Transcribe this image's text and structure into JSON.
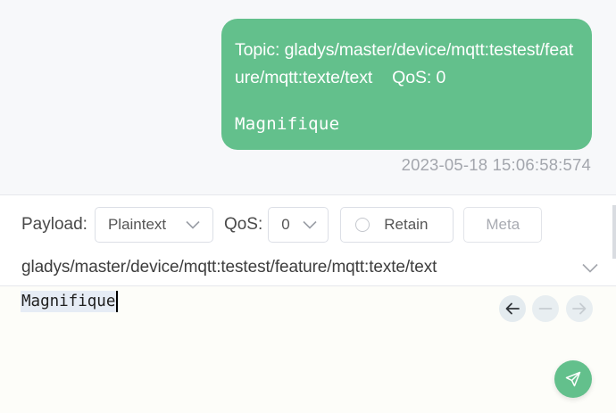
{
  "message": {
    "topic_label": "Topic: gladys/master/device/mqtt:testest/feature/mqtt:texte/text",
    "qos_label": "QoS: 0",
    "payload": "Magnifique",
    "timestamp": "2023-05-18 15:06:58:574"
  },
  "composer": {
    "payload_label": "Payload:",
    "payload_format": "Plaintext",
    "qos_label": "QoS:",
    "qos_value": "0",
    "retain_label": "Retain",
    "meta_label": "Meta",
    "topic": "gladys/master/device/mqtt:testest/feature/mqtt:texte/text",
    "editor_text": "Magnifique"
  },
  "icons": {
    "dropdown": "chevron-down-icon",
    "history_back": "arrow-left-icon",
    "history_clear": "minus-icon",
    "history_forward": "arrow-right-icon",
    "send": "paper-plane-icon"
  },
  "colors": {
    "accent": "#63c08c",
    "timestamp": "#a3a6ad",
    "border": "#dcdfe6",
    "editor_bg": "#fdfdf9",
    "selection": "#e6ecf5"
  }
}
